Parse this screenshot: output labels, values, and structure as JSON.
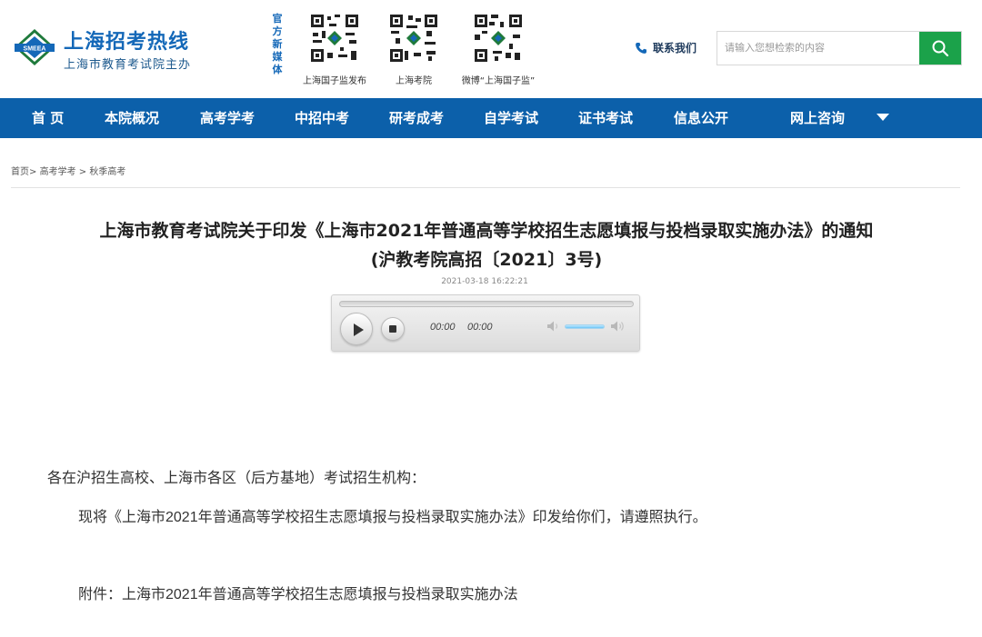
{
  "site": {
    "title": "上海招考热线",
    "subtitle": "上海市教育考试院主办",
    "logo_text": "SMEEA"
  },
  "media": {
    "label": "官方新媒体",
    "qrcodes": [
      {
        "label": "上海国子监发布"
      },
      {
        "label": "上海考院"
      },
      {
        "label": "微博“上海国子监”"
      }
    ]
  },
  "contact": {
    "label": "联系我们"
  },
  "search": {
    "placeholder": "请输入您想检索的内容",
    "value": ""
  },
  "nav": {
    "items": [
      "首 页",
      "本院概况",
      "高考学考",
      "中招中考",
      "研考成考",
      "自学考试",
      "证书考试",
      "信息公开",
      "网上咨询"
    ]
  },
  "breadcrumb": {
    "home": "首页>",
    "section": "高考学考",
    "sep": ">",
    "current": "秋季高考"
  },
  "article": {
    "title_line1": "上海市教育考试院关于印发《上海市2021年普通高等学校招生志愿填报与投档录取实施办法》的通知",
    "title_line2": "(沪教考院高招〔2021〕3号)",
    "date": "2021-03-18 16:22:21",
    "salutation": "各在沪招生高校、上海市各区（后方基地）考试招生机构：",
    "body": "现将《上海市2021年普通高等学校招生志愿填报与投档录取实施办法》印发给你们，请遵照执行。",
    "attachment": "附件：上海市2021年普通高等学校招生志愿填报与投档录取实施办法"
  },
  "player": {
    "current_time": "00:00",
    "duration": "00:00",
    "progress": 0,
    "volume": 1
  },
  "colors": {
    "brand_blue": "#1468b8",
    "nav_blue": "#0c60aa",
    "search_green": "#1ba24a"
  }
}
